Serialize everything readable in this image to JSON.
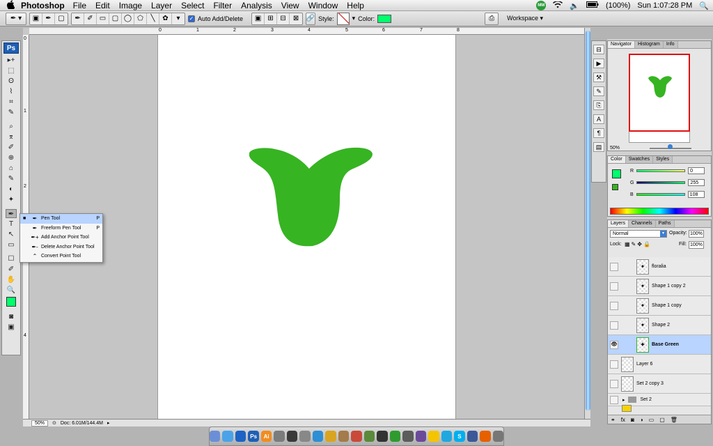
{
  "menubar": {
    "apple": "",
    "app_name": "Photoshop",
    "items": [
      "File",
      "Edit",
      "Image",
      "Layer",
      "Select",
      "Filter",
      "Analysis",
      "View",
      "Window",
      "Help"
    ],
    "mm_badge": "MM",
    "wifi": "wifi-icon",
    "volume": "🔈",
    "battery": "(100%)",
    "clock": "Sun 1:07:28 PM",
    "spotlight": "🔍"
  },
  "options": {
    "auto_add_delete": "Auto Add/Delete",
    "style_label": "Style:",
    "color_label": "Color:",
    "color": "#00ff6c",
    "workspace": "Workspace ▾"
  },
  "toolbox": {
    "logo": "Ps",
    "tools": [
      "▸+",
      "⬚",
      "ʘ",
      "⌇",
      "⌗",
      "✎",
      "⌕",
      "⌆",
      "✐",
      "⊕",
      "⌂",
      "✎",
      "◐",
      "✦",
      "◉",
      "✒",
      "T",
      "↖",
      "▭",
      "☐",
      "✐",
      "✋",
      "🔍"
    ],
    "foreground": "#00ff6c"
  },
  "canvas": {
    "ruler_top": [
      "0",
      "1",
      "2",
      "3",
      "4",
      "5",
      "6",
      "7",
      "8"
    ],
    "ruler_left": [
      "0",
      "1",
      "2",
      "3",
      "4"
    ],
    "shape_color": "#36b422",
    "zoom": "50%",
    "doc_info": "Doc: 6.01M/144.4M"
  },
  "flyout": {
    "items": [
      {
        "label": "Pen Tool",
        "shortcut": "P",
        "icon": "✒",
        "selected": true
      },
      {
        "label": "Freeform Pen Tool",
        "shortcut": "P",
        "icon": "✒"
      },
      {
        "label": "Add Anchor Point Tool",
        "shortcut": "",
        "icon": "✒+"
      },
      {
        "label": "Delete Anchor Point Tool",
        "shortcut": "",
        "icon": "✒-"
      },
      {
        "label": "Convert Point Tool",
        "shortcut": "",
        "icon": "⌃"
      }
    ]
  },
  "navigator": {
    "tabs": [
      "Navigator",
      "Histogram",
      "Info"
    ],
    "zoom": "50%"
  },
  "color_panel": {
    "tabs": [
      "Color",
      "Swatches",
      "Styles"
    ],
    "channels": [
      {
        "label": "R",
        "value": "0"
      },
      {
        "label": "G",
        "value": "255"
      },
      {
        "label": "B",
        "value": "108"
      }
    ]
  },
  "layers_panel": {
    "tabs": [
      "Layers",
      "Channels",
      "Paths"
    ],
    "blend_mode": "Normal",
    "opacity_label": "Opacity:",
    "opacity": "100%",
    "lock_label": "Lock:",
    "fill_label": "Fill:",
    "fill": "100%",
    "layers": [
      {
        "name": "floralia",
        "icon": "✦",
        "visible": false,
        "selected": false
      },
      {
        "name": "Shape 1 copy 2",
        "icon": "✦",
        "visible": false,
        "selected": false
      },
      {
        "name": "Shape 1 copy",
        "icon": "✦",
        "visible": false,
        "selected": false
      },
      {
        "name": "Shape 2",
        "icon": "✦",
        "visible": false,
        "selected": false
      },
      {
        "name": "Base Green",
        "icon": "✦",
        "visible": true,
        "selected": true
      },
      {
        "name": "Layer 6",
        "icon": "",
        "visible": false,
        "selected": false
      },
      {
        "name": "Set 2 copy 3",
        "icon": "",
        "visible": false,
        "selected": false
      },
      {
        "name": "Set 2",
        "icon": "▸",
        "visible": false,
        "selected": false
      }
    ],
    "footer_icons": [
      "link-icon",
      "fx-icon",
      "mask-icon",
      "adjust-icon",
      "folder-icon",
      "new-layer-icon",
      "trash-icon"
    ]
  },
  "dock": {
    "items": [
      {
        "label": "",
        "color": "#6b8fd6"
      },
      {
        "label": "",
        "color": "#4aa3e8"
      },
      {
        "label": "",
        "color": "#1d63c5"
      },
      {
        "label": "Ps",
        "color": "#1e5fb4"
      },
      {
        "label": "Ai",
        "color": "#f28c1e"
      },
      {
        "label": "",
        "color": "#7c7c7c"
      },
      {
        "label": "",
        "color": "#3a3a3a"
      },
      {
        "label": "",
        "color": "#888"
      },
      {
        "label": "",
        "color": "#2d8fd4"
      },
      {
        "label": "",
        "color": "#d9a520"
      },
      {
        "label": "",
        "color": "#a47b4a"
      },
      {
        "label": "",
        "color": "#c94a3a"
      },
      {
        "label": "",
        "color": "#5b8a3a"
      },
      {
        "label": "",
        "color": "#333"
      },
      {
        "label": "",
        "color": "#2f9b2f"
      },
      {
        "label": "",
        "color": "#5c5c5c"
      },
      {
        "label": "",
        "color": "#6b4a9a"
      },
      {
        "label": "",
        "color": "#f5c400"
      },
      {
        "label": "",
        "color": "#1fa8e0"
      },
      {
        "label": "S",
        "color": "#00aff0"
      },
      {
        "label": "",
        "color": "#3b5998"
      },
      {
        "label": "",
        "color": "#e66000"
      },
      {
        "label": "",
        "color": "#777"
      }
    ]
  }
}
